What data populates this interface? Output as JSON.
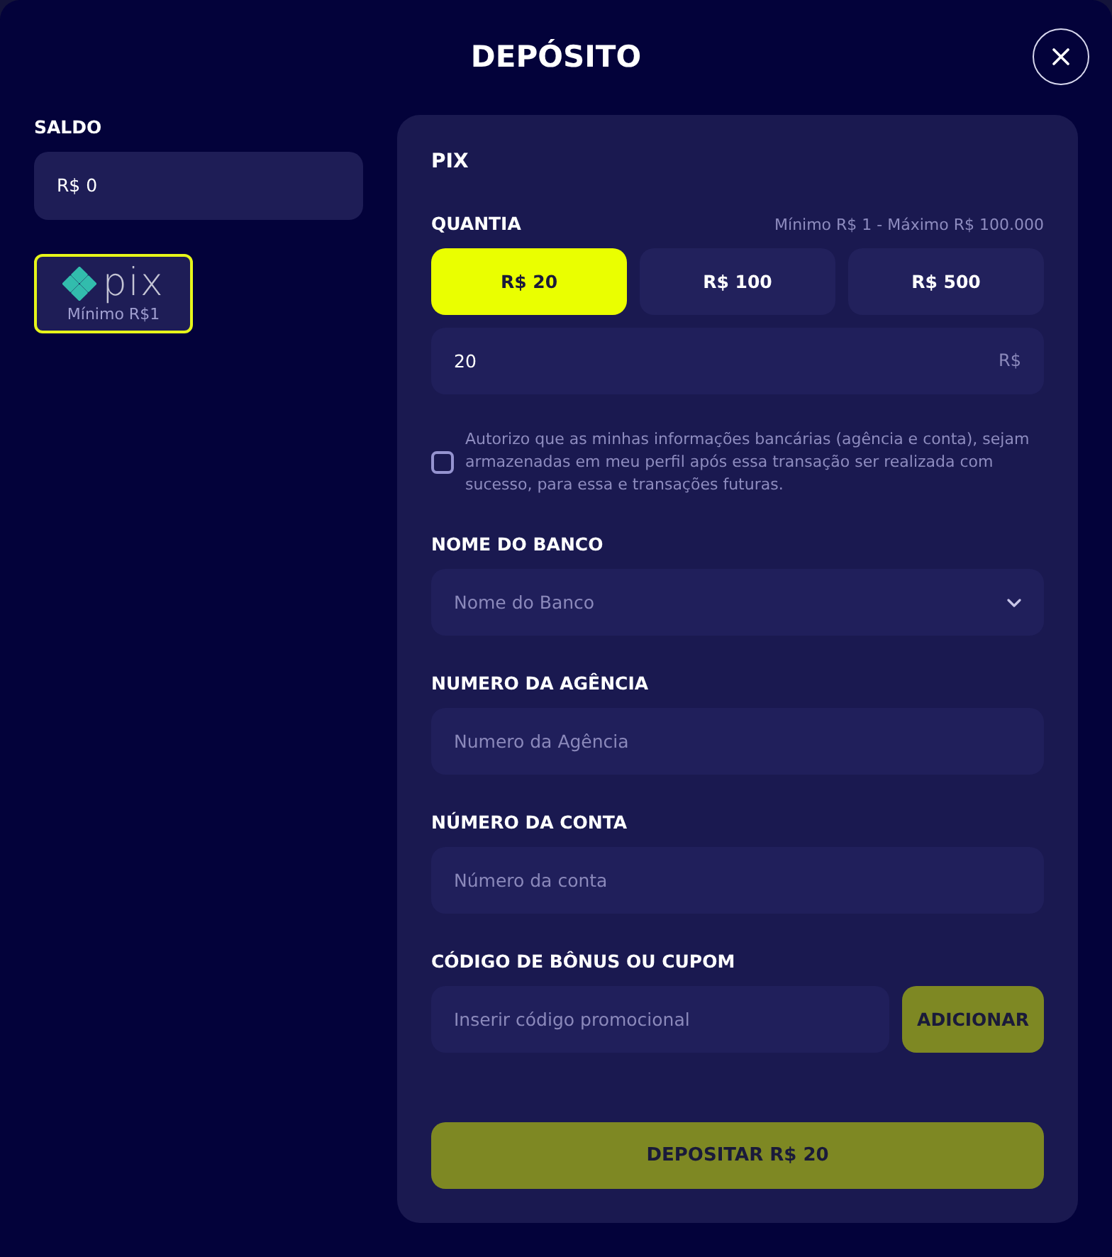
{
  "modal": {
    "title": "DEPÓSITO"
  },
  "balance": {
    "label": "SALDO",
    "value": "R$ 0"
  },
  "payment_methods": [
    {
      "wordmark": "pix",
      "caption": "Mínimo R$1",
      "selected": true
    }
  ],
  "panel": {
    "title": "PIX",
    "amount": {
      "label": "QUANTIA",
      "limits": "Mínimo R$ 1 - Máximo R$ 100.000",
      "presets": [
        {
          "label": "R$ 20",
          "selected": true
        },
        {
          "label": "R$ 100",
          "selected": false
        },
        {
          "label": "R$ 500",
          "selected": false
        }
      ],
      "value": "20",
      "currency": "R$"
    },
    "consent": {
      "text": "Autorizo que as minhas informações bancárias (agência e conta), sejam armazenadas em meu perfil após essa transação ser realizada com sucesso, para essa e transações futuras.",
      "checked": false
    },
    "fields": [
      {
        "kind": "select",
        "label": "NOME DO BANCO",
        "placeholder": "Nome do Banco"
      },
      {
        "kind": "text",
        "label": "NUMERO DA AGÊNCIA",
        "placeholder": "Numero da Agência"
      },
      {
        "kind": "text",
        "label": "NÚMERO DA CONTA",
        "placeholder": "Número da conta"
      },
      {
        "kind": "coupon",
        "label": "CÓDIGO DE BÔNUS OU CUPOM",
        "placeholder": "Inserir código promocional",
        "button": "ADICIONAR"
      }
    ],
    "submit": "DEPOSITAR R$ 20"
  }
}
